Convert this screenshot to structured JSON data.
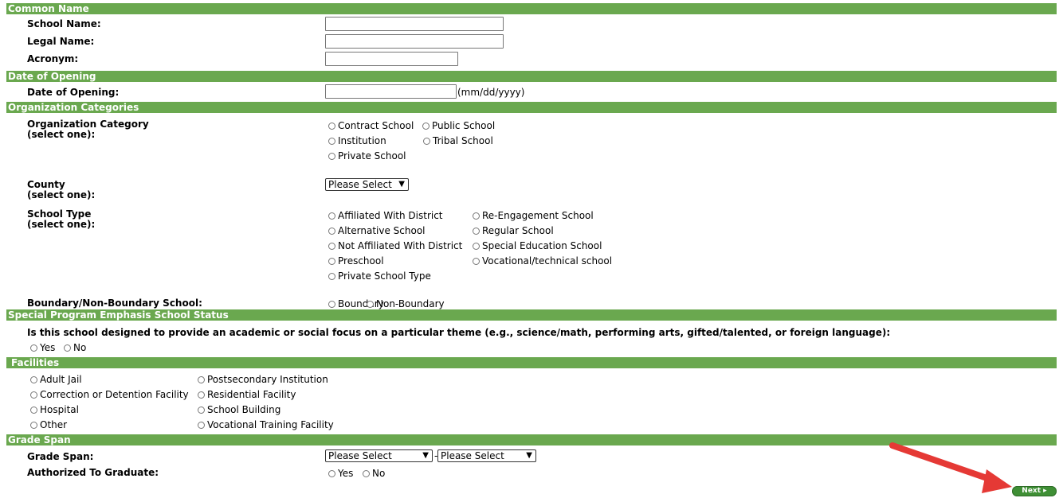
{
  "sections": {
    "common_name": "Common Name",
    "date_of_opening": "Date of Opening",
    "org_categories": "Organization Categories",
    "special_program": "Special Program Emphasis School Status",
    "facilities": "Facilities",
    "grade_span": "Grade Span"
  },
  "common_name": {
    "school_name_label": "School Name:",
    "legal_name_label": "Legal Name:",
    "acronym_label": "Acronym:"
  },
  "date_of_opening": {
    "label": "Date of Opening:",
    "hint": "(mm/dd/yyyy)"
  },
  "org_categories": {
    "category_label_1": "Organization Category",
    "category_label_2": "(select one):",
    "category_options": [
      "Contract School",
      "Public School",
      "Institution",
      "Tribal School",
      "Private School"
    ],
    "county_label_1": "County",
    "county_label_2": "(select one):",
    "county_selected": "Please Select",
    "school_type_label_1": "School Type",
    "school_type_label_2": "(select one):",
    "school_type_options": [
      "Affiliated With District",
      "Re-Engagement School",
      "Alternative School",
      "Regular School",
      "Not Affiliated With District",
      "Special Education School",
      "Preschool",
      "Vocational/technical school",
      "Private School Type"
    ],
    "boundary_label": "Boundary/Non-Boundary School:",
    "boundary_options": [
      "Boundary",
      "Non-Boundary"
    ]
  },
  "special_program": {
    "question": "Is this school designed to provide an academic or social focus on a particular theme (e.g., science/math, performing arts, gifted/talented, or foreign language):",
    "options": [
      "Yes",
      "No"
    ]
  },
  "facilities": {
    "options": [
      "Adult Jail",
      "Postsecondary Institution",
      "Correction or Detention Facility",
      "Residential Facility",
      "Hospital",
      "School Building",
      "Other",
      "Vocational Training Facility"
    ]
  },
  "grade_span": {
    "label": "Grade Span:",
    "from_selected": "Please Select",
    "separator": "-",
    "to_selected": "Please Select",
    "authorized_label": "Authorized To Graduate:",
    "authorized_options": [
      "Yes",
      "No"
    ]
  },
  "next_button": "Next ▸",
  "colors": {
    "header_green": "#6aa84f",
    "button_green": "#3f8f35",
    "arrow_red": "#e53935"
  }
}
